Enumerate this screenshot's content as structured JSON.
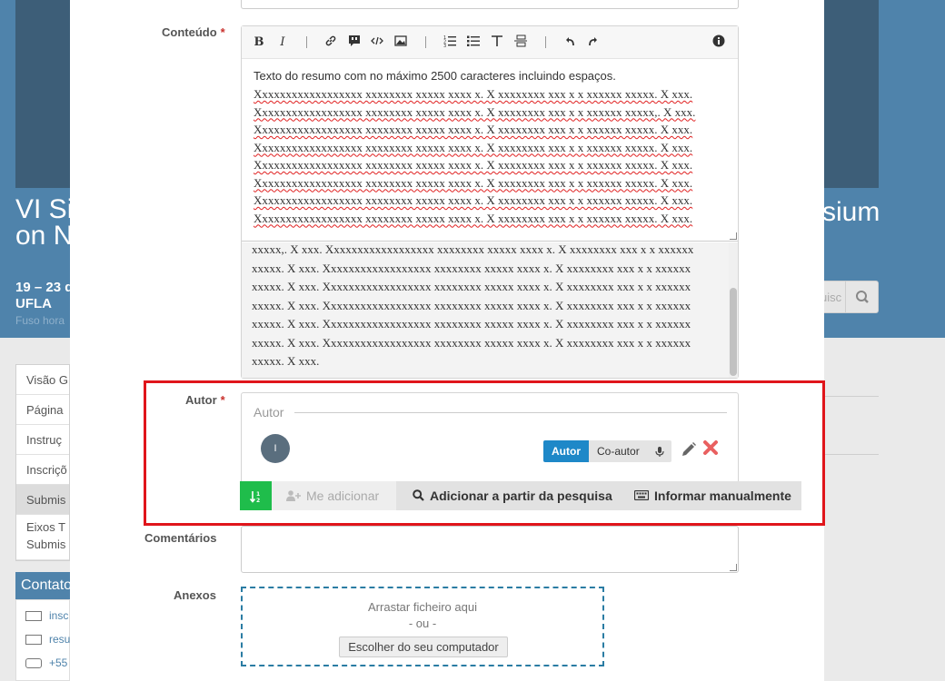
{
  "background": {
    "title_line1": "VI Si",
    "title_line2": "on N",
    "title_right": "sium",
    "dates": "19 – 23 d",
    "venue": "UFLA",
    "timezone": "Fuso hora",
    "search_placeholder": "uisc",
    "nav": [
      "Visão G",
      "Página",
      "Instruç",
      "Inscriçõ",
      "Submis"
    ],
    "nav_two_line": [
      "Eixos T",
      "Submis"
    ],
    "contact_title": "Contato",
    "contact_rows": [
      "insc",
      "resu",
      "+55"
    ]
  },
  "form": {
    "content_label": "Conteúdo",
    "required_mark": "*",
    "toolbar": {
      "bold": "B",
      "italic": "I",
      "info": "i"
    },
    "editor_first_line": "Texto do resumo com no máximo 2500 caracteres incluindo espaços.",
    "editor_lines": [
      "Xxxxxxxxxxxxxxxxxx xxxxxxxx xxxxx xxxx x. X xxxxxxxx xxx x x  xxxxxx xxxxx. X  xxx.",
      "Xxxxxxxxxxxxxxxxxx xxxxxxxx xxxxx xxxx x. X xxxxxxxx xxx x x  xxxxxx xxxxx,. X  xxx.",
      "Xxxxxxxxxxxxxxxxxx xxxxxxxx xxxxx xxxx x. X xxxxxxxx xxx x x  xxxxxx xxxxx. X  xxx.",
      "Xxxxxxxxxxxxxxxxxx xxxxxxxx xxxxx xxxx x. X xxxxxxxx xxx x x  xxxxxx xxxxx. X  xxx.",
      "Xxxxxxxxxxxxxxxxxx xxxxxxxx xxxxx xxxx x. X xxxxxxxx xxx x x  xxxxxx xxxxx. X  xxx.",
      "Xxxxxxxxxxxxxxxxxx xxxxxxxx xxxxx xxxx x. X xxxxxxxx xxx x x  xxxxxx xxxxx. X  xxx.",
      "Xxxxxxxxxxxxxxxxxx xxxxxxxx xxxxx xxxx x. X xxxxxxxx xxx x x  xxxxxx xxxxx. X  xxx.",
      "Xxxxxxxxxxxxxxxxxx xxxxxxxx xxxxx xxxx x. X xxxxxxxx xxx x x  xxxxxx xxxxx. X  xxx."
    ],
    "preview_text": "xxxxx,. X xxx. Xxxxxxxxxxxxxxxxxx xxxxxxxx xxxxx xxxx x. X xxxxxxxx xxx x x xxxxxx xxxxx. X xxx. Xxxxxxxxxxxxxxxxxx xxxxxxxx xxxxx xxxx x. X xxxxxxxx xxx x x xxxxxx xxxxx. X xxx. Xxxxxxxxxxxxxxxxxx xxxxxxxx xxxxx xxxx x. X xxxxxxxx xxx x x xxxxxx xxxxx. X xxx. Xxxxxxxxxxxxxxxxxx xxxxxxxx xxxxx xxxx x. X xxxxxxxx xxx x x xxxxxx xxxxx. X xxx. Xxxxxxxxxxxxxxxxxx xxxxxxxx xxxxx xxxx x. X xxxxxxxx xxx x x xxxxxx xxxxx. X xxx. Xxxxxxxxxxxxxxxxxx xxxxxxxx xxxxx xxxx x. X xxxxxxxx xxx x x xxxxxx xxxxx. X xxx.",
    "author_label": "Autor",
    "author_legend": "Autor",
    "author_avatar_initial": "I",
    "role_author": "Autor",
    "role_coauthor": "Co-autor",
    "add_me": "Me adicionar",
    "add_from_search": "Adicionar a partir da pesquisa",
    "add_manual": "Informar manualmente",
    "comments_label": "Comentários",
    "attachments_label": "Anexos",
    "drop_text": "Arrastar ficheiro aqui",
    "or_text": "- ou -",
    "choose_button": "Escolher do seu computador"
  },
  "colors": {
    "highlight": "#e0151b",
    "role_active": "#1e88c8",
    "sort_button": "#1fbd4b",
    "dropzone_border": "#2a7ca3"
  }
}
